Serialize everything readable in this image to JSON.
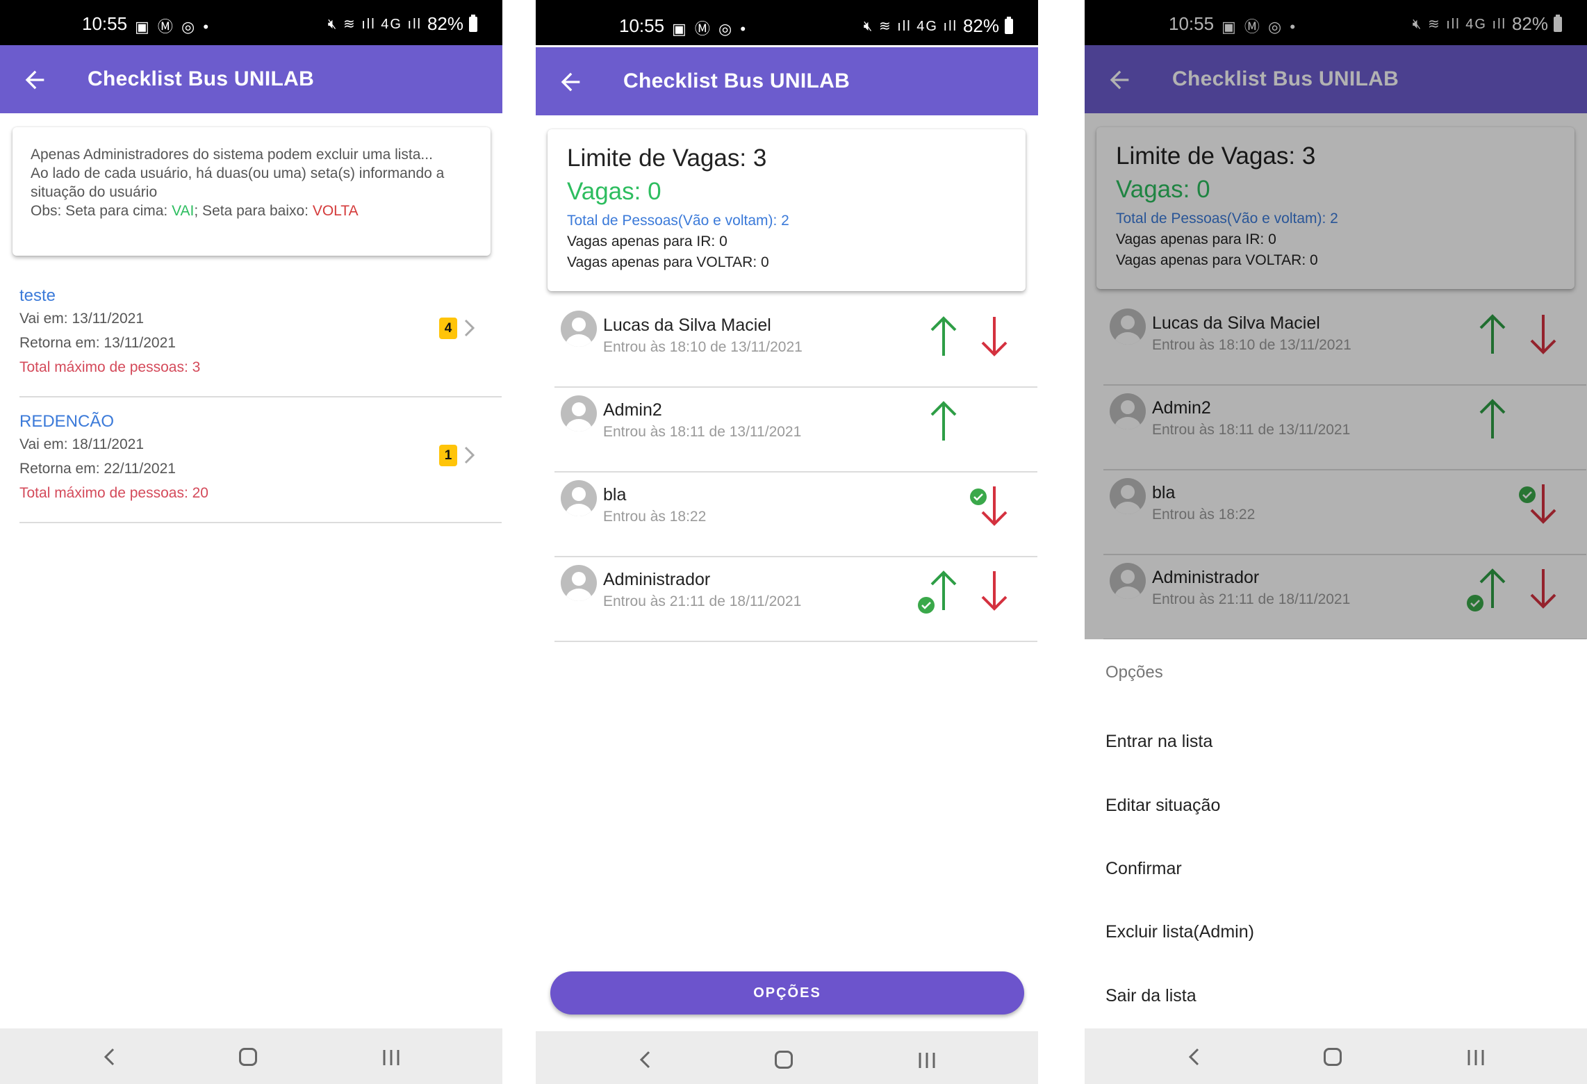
{
  "status": {
    "time": "10:55",
    "battery": "82%",
    "network": "4G"
  },
  "app": {
    "title": "Checklist Bus UNILAB"
  },
  "screen1": {
    "info": {
      "line1": "Apenas Administradores do sistema podem excluir uma lista...",
      "line2": "Ao lado de cada usuário, há duas(ou uma) seta(s) informando a",
      "line3": "situação do usuário",
      "obs_prefix": "Obs: Seta para cima: ",
      "obs_vai": "VAI",
      "obs_mid": "; Seta para baixo: ",
      "obs_volta": "VOLTA"
    },
    "lists": [
      {
        "name": "teste",
        "vai": "Vai em: 13/11/2021",
        "retorna": "Retorna em: 13/11/2021",
        "total": "Total máximo de pessoas: 3",
        "count": "4"
      },
      {
        "name": "REDENCÃO",
        "vai": "Vai em: 18/11/2021",
        "retorna": "Retorna em: 22/11/2021",
        "total": "Total máximo de pessoas: 20",
        "count": "1"
      }
    ]
  },
  "screen2": {
    "summary": {
      "limit": "Limite de Vagas: 3",
      "vagas": "Vagas: 0",
      "total": "Total de Pessoas(Vão e voltam): 2",
      "ir": "Vagas apenas para IR: 0",
      "voltar": "Vagas apenas para VOLTAR: 0"
    },
    "people": [
      {
        "name": "Lucas da Silva Maciel",
        "entered": "Entrou às 18:10 de 13/11/2021"
      },
      {
        "name": "Admin2",
        "entered": "Entrou às 18:11 de 13/11/2021"
      },
      {
        "name": "bla",
        "entered": "Entrou às 18:22"
      },
      {
        "name": "Administrador",
        "entered": "Entrou às 21:11 de 18/11/2021"
      }
    ],
    "button": "OPÇÕES"
  },
  "sheet": {
    "title": "Opções",
    "items": [
      "Entrar na lista",
      "Editar situação",
      "Confirmar",
      "Excluir lista(Admin)",
      "Sair da lista"
    ]
  },
  "colors": {
    "primary": "#6c5ccd",
    "up": "#2e9e46",
    "down": "#d4313f",
    "link": "#3b7ad9",
    "green_text": "#2dbd5f",
    "red_text": "#d44a5a"
  }
}
